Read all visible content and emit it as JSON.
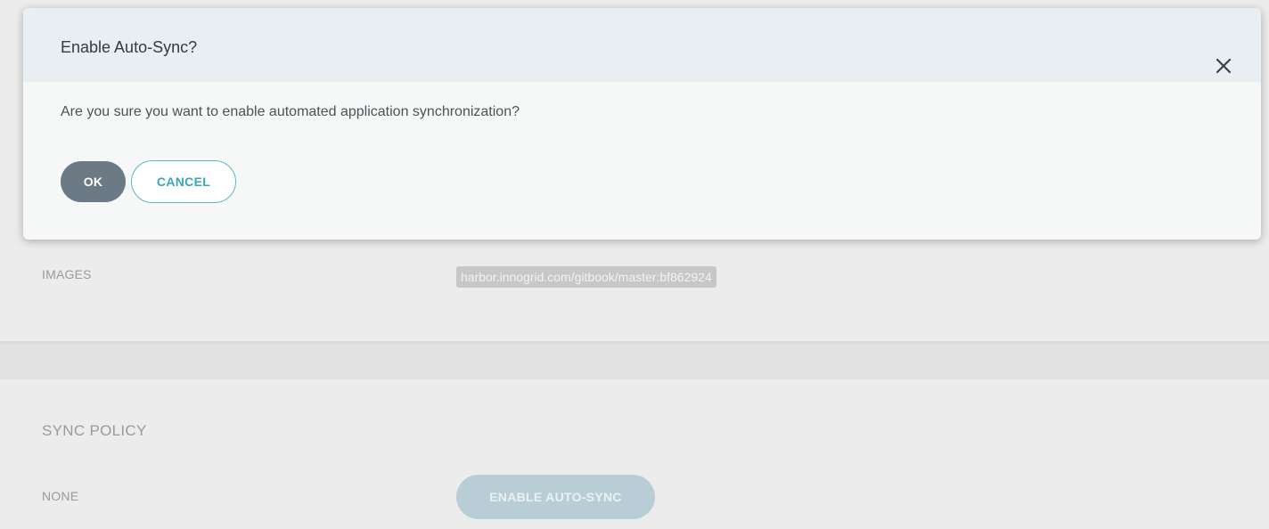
{
  "dialog": {
    "title": "Enable Auto-Sync?",
    "message": "Are you sure you want to enable automated application synchronization?",
    "ok_label": "OK",
    "cancel_label": "CANCEL",
    "close_icon": "close-icon"
  },
  "background": {
    "images_label": "IMAGES",
    "image_value": "harbor.innogrid.com/gitbook/master:bf862924",
    "sync_policy_title": "SYNC POLICY",
    "sync_policy_value": "NONE",
    "enable_autosync_label": "ENABLE AUTO-SYNC"
  },
  "colors": {
    "ok_button": "#6c7a86",
    "cancel_accent": "#3aa5b5",
    "dialog_header": "#e8eef2",
    "disabled_button": "#b9cdd6"
  }
}
